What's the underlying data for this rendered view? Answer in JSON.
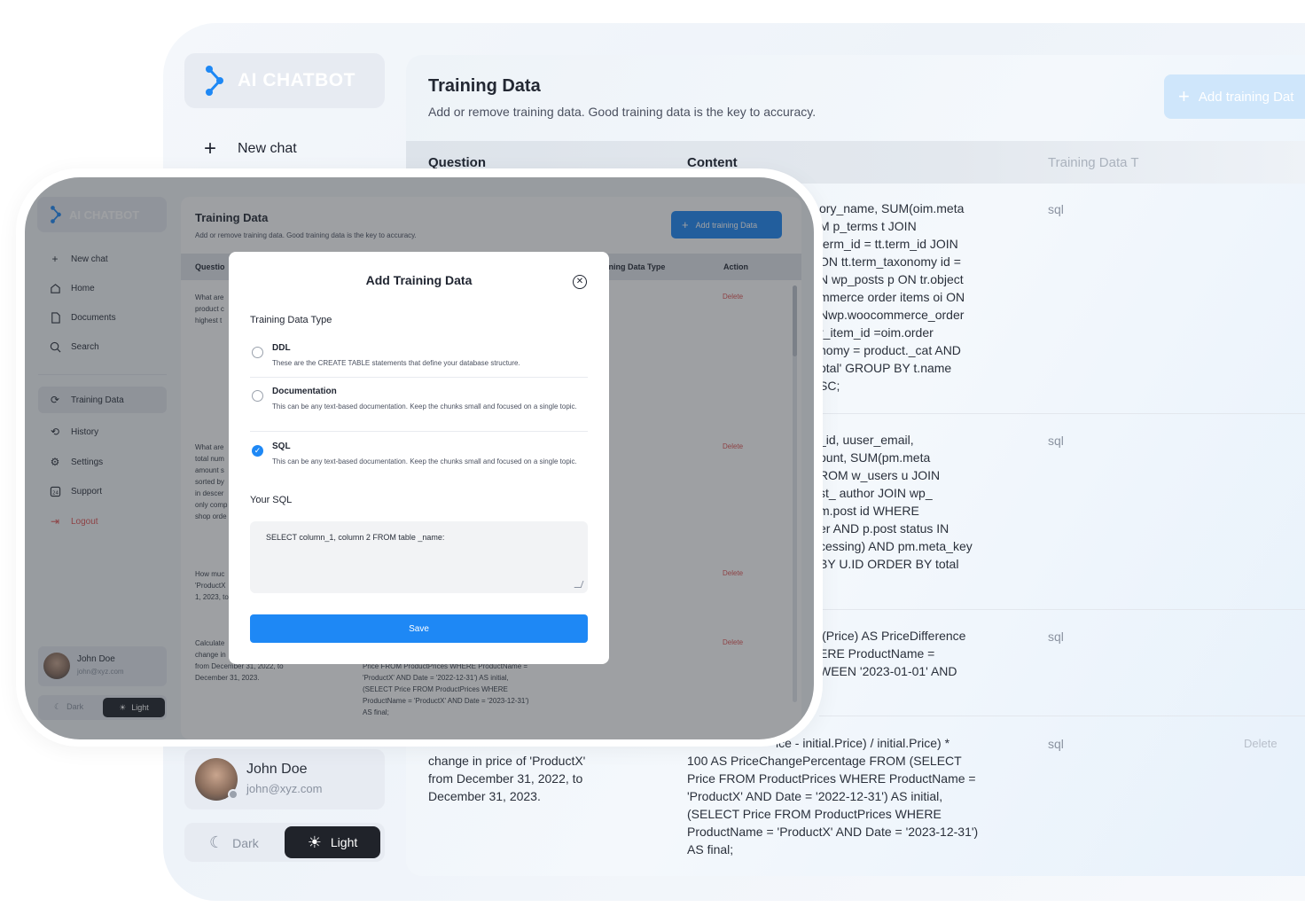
{
  "app": {
    "logo_text": "AI CHATBOT"
  },
  "colors": {
    "accent": "#1e88f5",
    "delete": "#e05555",
    "sidebar_bg": "#e6eaf0"
  },
  "background_app": {
    "new_chat_label": "New chat",
    "title": "Training Data",
    "subtitle": "Add or remove training data. Good training data is the key to accuracy.",
    "add_button_label": "Add training Dat",
    "columns": {
      "question": "Question",
      "content": "Content",
      "type": "Training Data T"
    },
    "rows": [
      {
        "content": [
          "ory_name, SUM(oim.meta",
          "M p_terms t JOIN",
          "term_id = tt.term_id JOIN",
          "ON tt.term_taxonomy id =",
          "N wp_posts p ON tr.object",
          "mmerce order items oi ON",
          "Nwp.woocommerce_order",
          "r_item_id =oim.order",
          "nomy = product._cat AND",
          "otal' GROUP BY t.name",
          "SC;"
        ],
        "type": "sql"
      },
      {
        "content": [
          "_id, uuser_email,",
          "ount, SUM(pm.meta",
          "ROM w_users u JOIN",
          "st_ author JOIN wp_",
          "m.post id WHERE",
          "er AND p.post status IN",
          "cessing) AND pm.meta_key",
          "BY U.ID ORDER BY total"
        ],
        "type": "sql"
      },
      {
        "content": [
          "l(Price) AS PriceDifference",
          "ERE ProductName =",
          "WEEN '2023-01-01' AND"
        ],
        "type": "sql"
      },
      {
        "question": [
          "change in price of 'ProductX'",
          "from December 31, 2022, to",
          "December 31, 2023."
        ],
        "content": [
          "ice - initial.Price) / initial.Price) *",
          "100 AS PriceChangePercentage FROM (SELECT",
          "Price FROM ProductPrices WHERE ProductName =",
          "'ProductX' AND Date = '2022-12-31') AS initial,",
          "(SELECT Price FROM ProductPrices WHERE",
          "ProductName = 'ProductX' AND Date = '2023-12-31')",
          "AS final;"
        ],
        "type": "sql",
        "action": "Delete"
      }
    ],
    "user": {
      "name": "John Doe",
      "email": "john@xyz.com"
    },
    "theme": {
      "dark": "Dark",
      "light": "Light"
    }
  },
  "foreground_app": {
    "sidebar": {
      "items": [
        {
          "label": "New chat",
          "icon": "plus-icon"
        },
        {
          "label": "Home",
          "icon": "home-icon"
        },
        {
          "label": "Documents",
          "icon": "document-icon"
        },
        {
          "label": "Search",
          "icon": "search-icon"
        },
        {
          "label": "Training Data",
          "icon": "refresh-icon"
        },
        {
          "label": "History",
          "icon": "history-icon"
        },
        {
          "label": "Settings",
          "icon": "gear-icon"
        },
        {
          "label": "Support",
          "icon": "support-icon"
        },
        {
          "label": "Logout",
          "icon": "logout-icon"
        }
      ],
      "user": {
        "name": "John Doe",
        "email": "john@xyz.com"
      },
      "theme": {
        "dark": "Dark",
        "light": "Light"
      }
    },
    "main": {
      "title": "Training Data",
      "subtitle": "Add or remove training data. Good training data is the key to accuracy.",
      "add_button_label": "Add training Data",
      "columns": {
        "question": "Questio",
        "type": "ining Data Type",
        "action": "Action"
      },
      "rows": [
        {
          "question": [
            "What are",
            "product c",
            "highest t"
          ],
          "action": "Delete"
        },
        {
          "question": [
            "What are",
            "total num",
            "amount s",
            "sorted by",
            "in descer",
            "only comp",
            "shop orde"
          ],
          "action": "Delete"
        },
        {
          "question": [
            "How muc",
            "'ProductX",
            "1, 2023, to"
          ],
          "action": "Delete"
        },
        {
          "question": [
            "Calculate",
            "change in",
            "from December 31, 2022, to",
            "December 31, 2023."
          ],
          "content": [
            "Price FROM ProductPrices WHERE ProductName =",
            "'ProductX' AND Date = '2022-12-31') AS initial,",
            "(SELECT Price FROM ProductPrices WHERE",
            "ProductName = 'ProductX' AND Date = '2023-12-31')",
            "AS final;"
          ],
          "action": "Delete"
        }
      ]
    },
    "modal": {
      "title": "Add Training Data",
      "type_label": "Training Data Type",
      "options": [
        {
          "title": "DDL",
          "desc": "These are the CREATE TABLE statements that define your database structure.",
          "checked": false
        },
        {
          "title": "Documentation",
          "desc": "This can be any text-based documentation. Keep the chunks small and focused on a single topic.",
          "checked": false
        },
        {
          "title": "SQL",
          "desc": "This can be any text-based documentation. Keep the chunks small and focused on a single topic.",
          "checked": true
        }
      ],
      "sql_label": "Your SQL",
      "sql_value": "SELECT column_1, column 2 FROM table _name:",
      "save_label": "Save"
    }
  }
}
